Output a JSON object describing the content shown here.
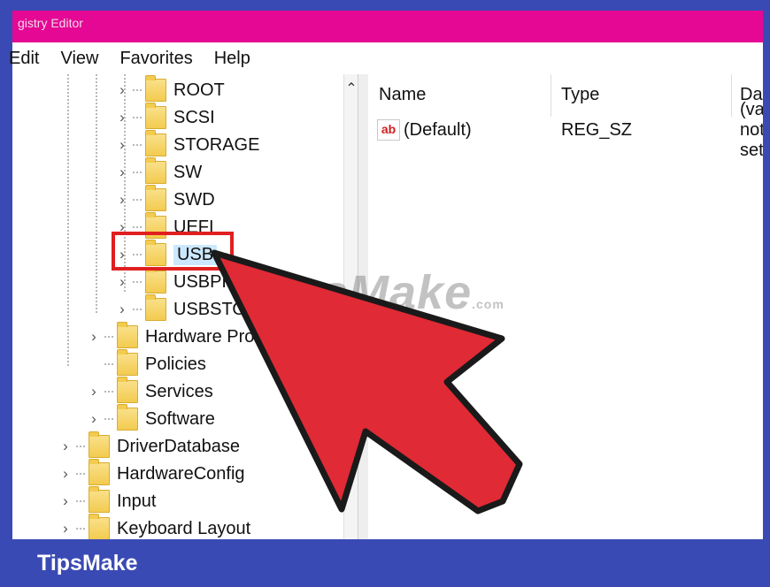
{
  "window": {
    "title": "gistry Editor"
  },
  "menu": {
    "items": [
      "Edit",
      "View",
      "Favorites",
      "Help"
    ]
  },
  "tree": {
    "items": [
      {
        "label": "ROOT"
      },
      {
        "label": "SCSI"
      },
      {
        "label": "STORAGE"
      },
      {
        "label": "SW"
      },
      {
        "label": "SWD"
      },
      {
        "label": "UEFI"
      },
      {
        "label": "USB",
        "selected": true
      },
      {
        "label": "USBPRINT"
      },
      {
        "label": "USBSTOR"
      },
      {
        "label": "Hardware Profiles"
      },
      {
        "label": "Policies"
      },
      {
        "label": "Services"
      },
      {
        "label": "Software"
      },
      {
        "label": "DriverDatabase"
      },
      {
        "label": "HardwareConfig"
      },
      {
        "label": "Input"
      },
      {
        "label": "Keyboard Layout"
      }
    ]
  },
  "values_table": {
    "columns": [
      "Name",
      "Type",
      "Data"
    ],
    "rows": [
      {
        "icon": "ab",
        "name": "(Default)",
        "type": "REG_SZ",
        "data": "(value not set)"
      }
    ]
  },
  "overlay": {
    "watermark": "TipsMake",
    "watermark_suffix": ".com",
    "brand": "TipsMake"
  },
  "colors": {
    "frame": "#3a4ab4",
    "title_bar": "#e40894",
    "highlight": "#e02020",
    "arrow": "#e02a35"
  }
}
